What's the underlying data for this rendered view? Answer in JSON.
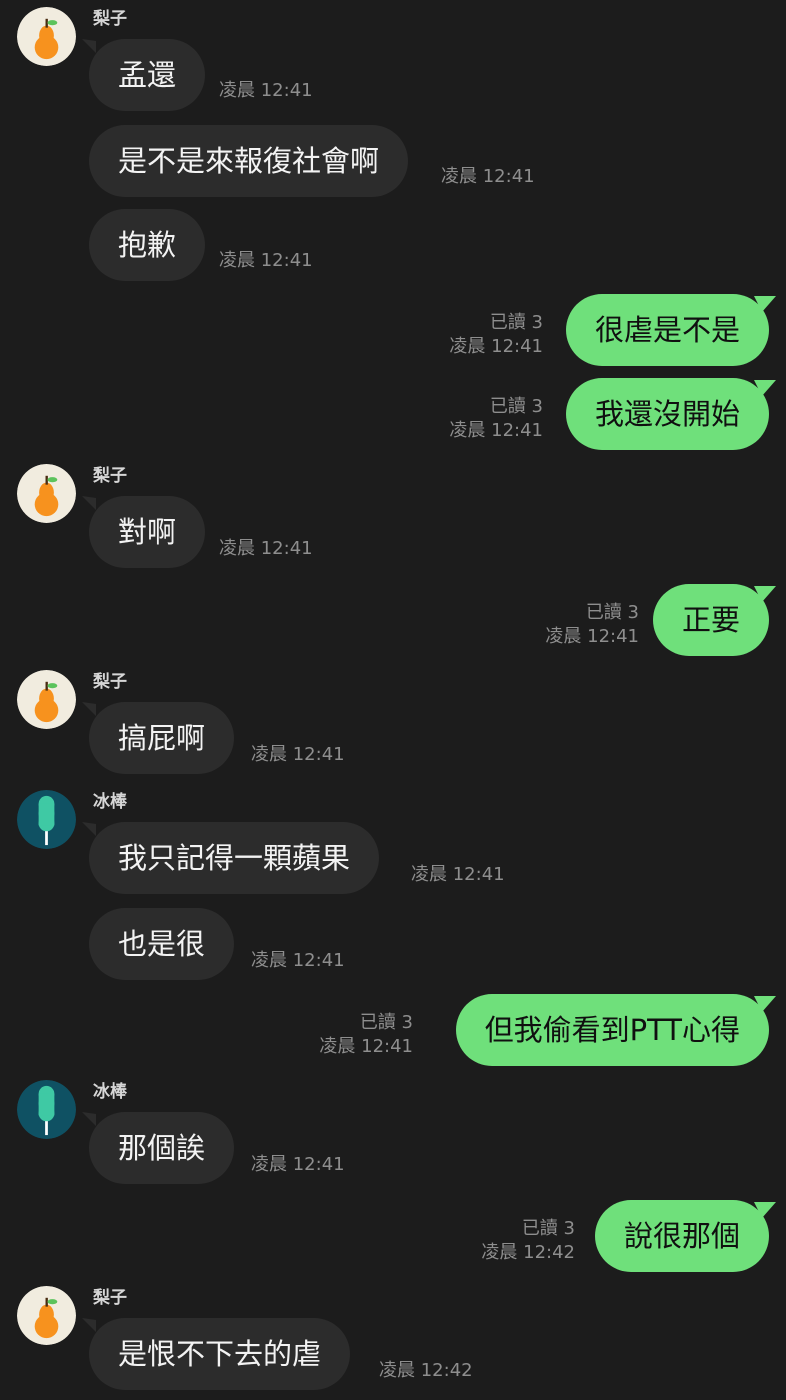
{
  "contacts": {
    "lizi": {
      "name": "梨子",
      "avatar_icon": "pear-icon",
      "avatar_bg": "#f1ecdf"
    },
    "bingbang": {
      "name": "冰棒",
      "avatar_icon": "popsicle-icon",
      "avatar_bg": "#0f5163"
    }
  },
  "colors": {
    "background": "#1c1c1c",
    "incoming_bubble": "#2c2c2c",
    "outgoing_bubble": "#6fe07b",
    "timestamp": "#8e8e8e"
  },
  "messages": [
    {
      "id": 1,
      "dir": "in",
      "sender": "梨子",
      "text": "孟還",
      "time": "凌晨 12:41"
    },
    {
      "id": 2,
      "dir": "in",
      "sender": "梨子",
      "text": "是不是來報復社會啊",
      "time": "凌晨 12:41"
    },
    {
      "id": 3,
      "dir": "in",
      "sender": "梨子",
      "text": "抱歉",
      "time": "凌晨 12:41"
    },
    {
      "id": 4,
      "dir": "out",
      "read": "已讀 3",
      "text": "很虐是不是",
      "time": "凌晨 12:41"
    },
    {
      "id": 5,
      "dir": "out",
      "read": "已讀 3",
      "text": "我還沒開始",
      "time": "凌晨 12:41"
    },
    {
      "id": 6,
      "dir": "in",
      "sender": "梨子",
      "text": "對啊",
      "time": "凌晨 12:41"
    },
    {
      "id": 7,
      "dir": "out",
      "read": "已讀 3",
      "text": "正要",
      "time": "凌晨 12:41"
    },
    {
      "id": 8,
      "dir": "in",
      "sender": "梨子",
      "text": "搞屁啊",
      "time": "凌晨 12:41"
    },
    {
      "id": 9,
      "dir": "in",
      "sender": "冰棒",
      "text": "我只記得一顆蘋果",
      "time": "凌晨 12:41"
    },
    {
      "id": 10,
      "dir": "in",
      "sender": "冰棒",
      "text": "也是很",
      "time": "凌晨 12:41"
    },
    {
      "id": 11,
      "dir": "out",
      "read": "已讀 3",
      "text": "但我偷看到PTT心得",
      "time": "凌晨 12:41"
    },
    {
      "id": 12,
      "dir": "in",
      "sender": "冰棒",
      "text": "那個誒",
      "time": "凌晨 12:41"
    },
    {
      "id": 13,
      "dir": "out",
      "read": "已讀 3",
      "text": "說很那個",
      "time": "凌晨 12:42"
    },
    {
      "id": 14,
      "dir": "in",
      "sender": "梨子",
      "text": "是恨不下去的虐",
      "time": "凌晨 12:42"
    }
  ]
}
